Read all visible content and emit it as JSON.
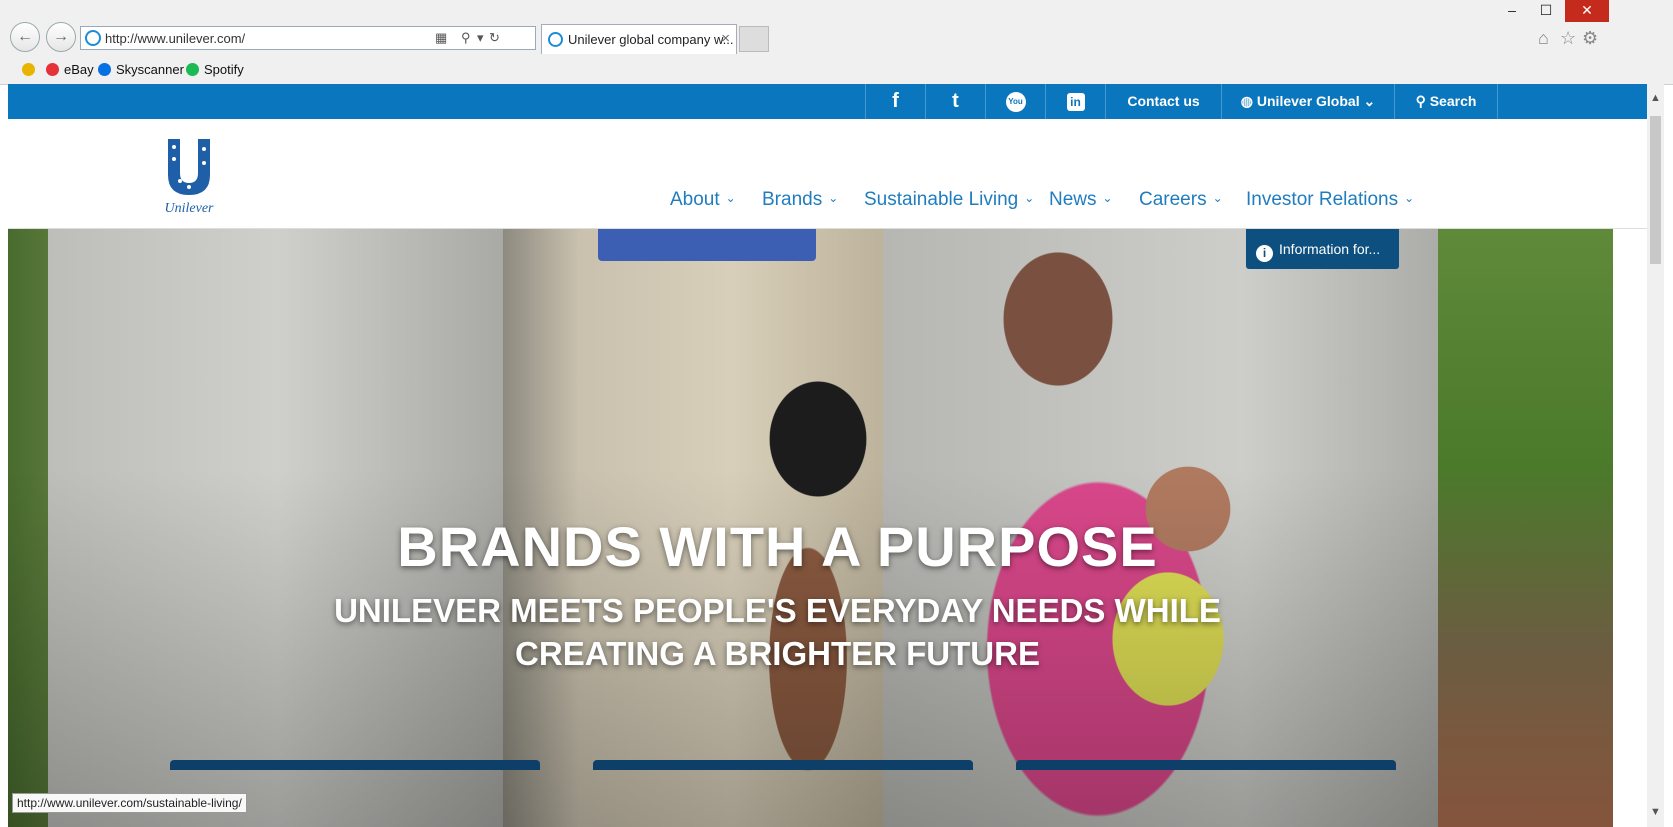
{
  "browser": {
    "address_url": "http://www.unilever.com/",
    "tab_title": "Unilever global company w...",
    "tab_close": "×",
    "back_glyph": "←",
    "forward_glyph": "→",
    "favorites": [
      {
        "label": "eBay",
        "color": "#e53238"
      },
      {
        "label": "Skyscanner",
        "color": "#0770e3"
      },
      {
        "label": "Spotify",
        "color": "#1db954"
      }
    ],
    "status_url": "http://www.unilever.com/sustainable-living/"
  },
  "utility_bar": {
    "social": [
      {
        "name": "facebook",
        "glyph": "f"
      },
      {
        "name": "twitter",
        "glyph": "t"
      },
      {
        "name": "youtube",
        "glyph": "You"
      },
      {
        "name": "linkedin",
        "glyph": "in"
      }
    ],
    "contact": "Contact us",
    "region": "Unilever Global",
    "search": "Search"
  },
  "logo": {
    "text": "Unilever"
  },
  "main_nav": [
    {
      "label": "About"
    },
    {
      "label": "Brands"
    },
    {
      "label": "Sustainable Living"
    },
    {
      "label": "News"
    },
    {
      "label": "Careers"
    },
    {
      "label": "Investor Relations"
    }
  ],
  "info_button": "Information for...",
  "hero": {
    "title": "BRANDS WITH A PURPOSE",
    "subtitle_line1": "UNILEVER MEETS PEOPLE'S EVERYDAY NEEDS WHILE",
    "subtitle_line2": "CREATING A BRIGHTER FUTURE"
  },
  "colors": {
    "brand_blue": "#0a76bd",
    "nav_blue": "#1f7dbf",
    "dark_blue": "#0d4f7e"
  }
}
